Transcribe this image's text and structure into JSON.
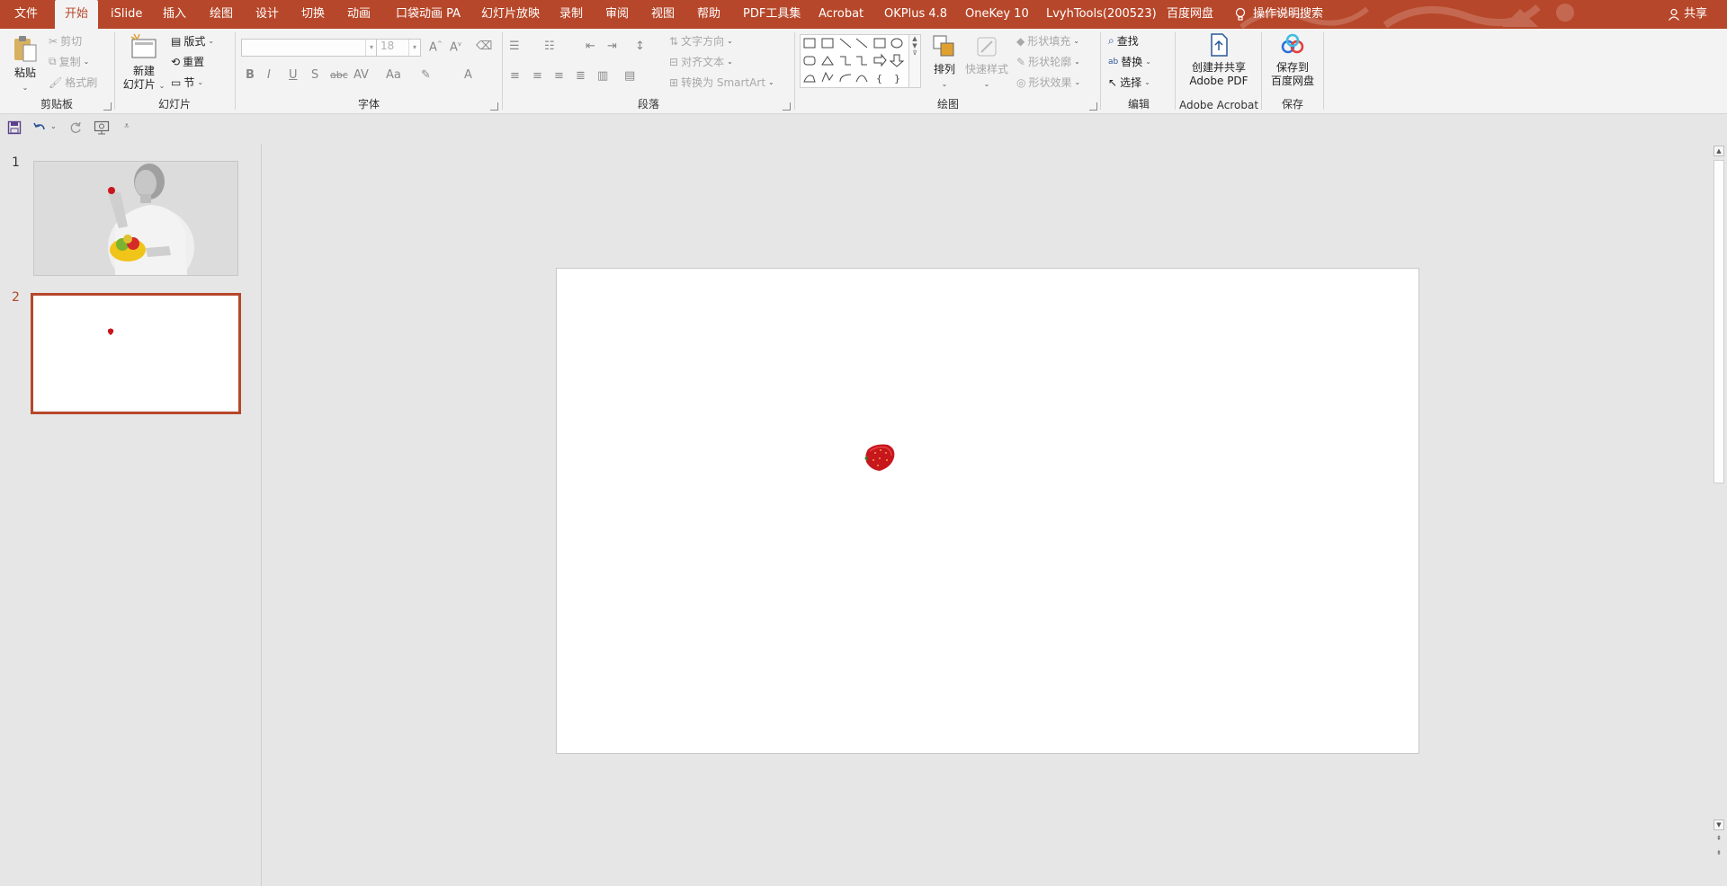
{
  "menu": {
    "tabs": [
      "文件",
      "开始",
      "iSlide",
      "插入",
      "绘图",
      "设计",
      "切换",
      "动画",
      "口袋动画 PA",
      "幻灯片放映",
      "录制",
      "审阅",
      "视图",
      "帮助",
      "PDF工具集",
      "Acrobat",
      "OKPlus 4.8",
      "OneKey 10",
      "LvyhTools(200523)",
      "百度网盘"
    ],
    "active": "开始",
    "tell_me": "操作说明搜索",
    "share": "共享"
  },
  "ribbon": {
    "clipboard": {
      "label": "剪贴板",
      "paste": "粘贴",
      "cut": "剪切",
      "copy": "复制",
      "format_painter": "格式刷"
    },
    "slides": {
      "label": "幻灯片",
      "new_slide": "新建\n幻灯片",
      "new_slide_l1": "新建",
      "new_slide_l2": "幻灯片",
      "layout": "版式",
      "reset": "重置",
      "section": "节"
    },
    "font": {
      "label": "字体",
      "font_name": "",
      "font_size": "18"
    },
    "paragraph": {
      "label": "段落",
      "text_direction": "文字方向",
      "align_text": "对齐文本",
      "convert_smartart": "转换为 SmartArt"
    },
    "drawing": {
      "label": "绘图",
      "arrange": "排列",
      "quick_styles": "快速样式",
      "shape_fill": "形状填充",
      "shape_outline": "形状轮廓",
      "shape_effects": "形状效果"
    },
    "editing": {
      "label": "编辑",
      "find": "查找",
      "replace": "替换",
      "select": "选择"
    },
    "acrobat": {
      "label": "Adobe Acrobat",
      "create_share_l1": "创建并共享",
      "create_share_l2": "Adobe PDF"
    },
    "save": {
      "label": "保存",
      "save_baidu_l1": "保存到",
      "save_baidu_l2": "百度网盘"
    }
  },
  "slides": [
    {
      "number": "1",
      "active": false
    },
    {
      "number": "2",
      "active": true
    }
  ],
  "colors": {
    "accent": "#b7472a",
    "strawberry": "#c8161d"
  }
}
